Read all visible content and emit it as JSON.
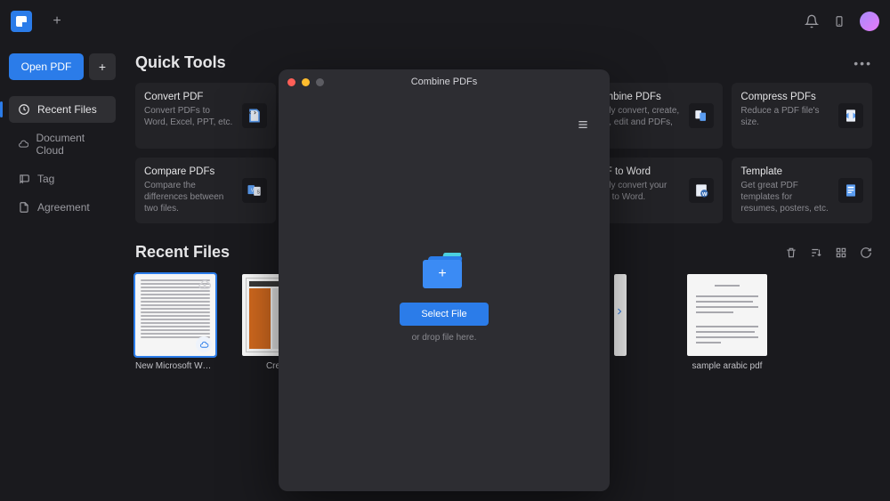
{
  "app": {
    "open_pdf_label": "Open PDF"
  },
  "sidebar": {
    "items": [
      {
        "label": "Recent Files"
      },
      {
        "label": "Document Cloud"
      },
      {
        "label": "Tag"
      },
      {
        "label": "Agreement"
      }
    ]
  },
  "sections": {
    "quick_tools": "Quick Tools",
    "recent_files": "Recent Files"
  },
  "tools": [
    {
      "title": "Convert PDF",
      "desc": "Convert PDFs to Word, Excel, PPT, etc."
    },
    {
      "title": "Compare PDFs",
      "desc": "Compare the differences between two files."
    },
    {
      "title": "Combine PDFs",
      "desc": "Easily convert, create, print, edit and PDFs, etc."
    },
    {
      "title": "PDF to Word",
      "desc": "Easily convert your PDF to Word."
    },
    {
      "title": "Compress PDFs",
      "desc": "Reduce a PDF file's size."
    },
    {
      "title": "Template",
      "desc": "Get great PDF templates for resumes, posters, etc."
    }
  ],
  "recent": [
    {
      "label": "New Microsoft Wo…"
    },
    {
      "label": "CreateF"
    },
    {
      "label": ""
    },
    {
      "label": "sample arabic pdf"
    }
  ],
  "modal": {
    "title": "Combine PDFs",
    "select_file": "Select File",
    "drop_hint": "or drop file here."
  },
  "colors": {
    "accent": "#2b7ce9",
    "traffic_red": "#ff5f57",
    "traffic_yellow": "#febc2e",
    "traffic_green": "#5c5c62"
  }
}
